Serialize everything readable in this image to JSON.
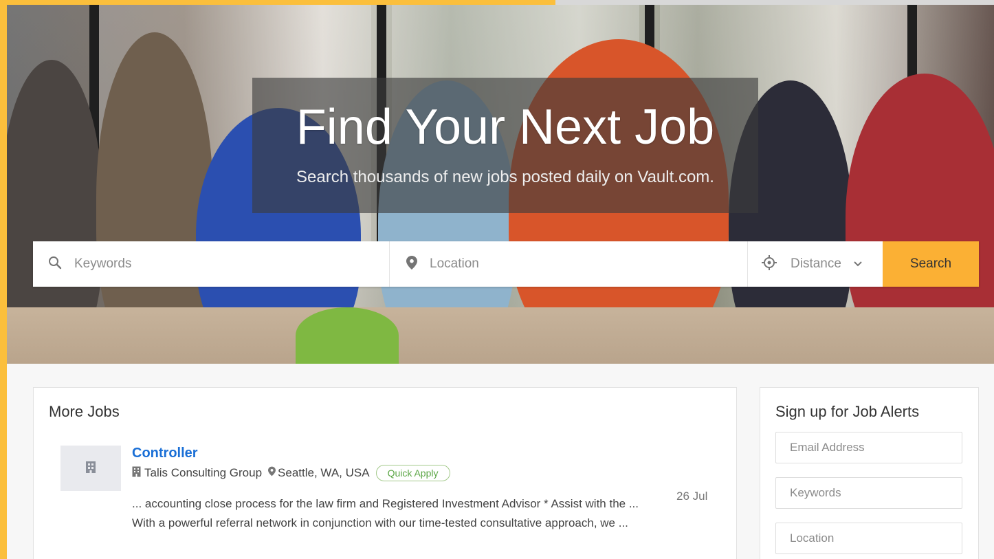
{
  "hero": {
    "title": "Find Your Next Job",
    "subtitle": "Search thousands of new jobs posted daily on Vault.com."
  },
  "search": {
    "keywords_placeholder": "Keywords",
    "location_placeholder": "Location",
    "distance_label": "Distance",
    "button_label": "Search",
    "accent_color": "#fbb034"
  },
  "more_jobs": {
    "title": "More Jobs",
    "jobs": [
      {
        "title": "Controller",
        "company": "Talis Consulting Group",
        "location": "Seattle, WA, USA",
        "badge": "Quick Apply",
        "date": "26 Jul",
        "snippet": "... accounting close process for the law firm and Registered Investment Advisor * Assist with the ... With a powerful referral network in conjunction with our time-tested consultative approach, we ..."
      }
    ]
  },
  "alerts": {
    "title": "Sign up for Job Alerts",
    "email_placeholder": "Email Address",
    "keywords_placeholder": "Keywords",
    "location_placeholder": "Location"
  },
  "icons": {
    "keywords": "search-icon",
    "location": "map-pin-icon",
    "distance": "crosshair-icon",
    "dropdown": "chevron-down-icon",
    "company": "building-icon"
  }
}
